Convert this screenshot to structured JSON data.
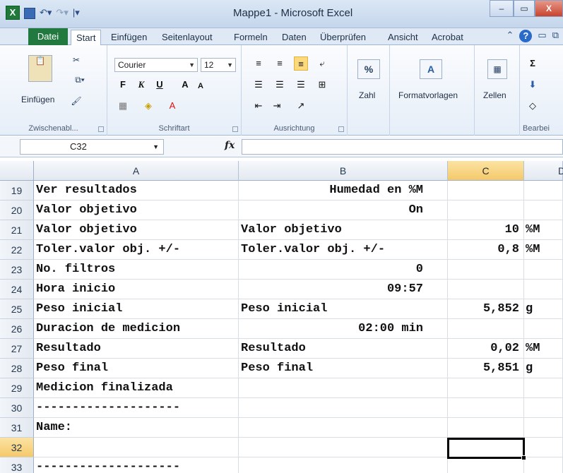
{
  "window": {
    "app_icon": "X",
    "title": "Mappe1 - Microsoft Excel",
    "min_label": "–",
    "max_label": "▭",
    "close_label": "X"
  },
  "ribbon_tabs": [
    "Datei",
    "Start",
    "Einfügen",
    "Seitenlayout",
    "Formeln",
    "Daten",
    "Überprüfen",
    "Ansicht",
    "Acrobat"
  ],
  "ribbon": {
    "clipboard": {
      "paste_label": "Einfügen",
      "group_label": "Zwischenabl..."
    },
    "font": {
      "font_name": "Courier",
      "font_size": "12",
      "bold": "F",
      "italic": "K",
      "underline": "U",
      "grow": "A",
      "shrink": "A",
      "group_label": "Schriftart"
    },
    "alignment": {
      "group_label": "Ausrichtung"
    },
    "number": {
      "label": "Zahl",
      "symbol": "%"
    },
    "styles": {
      "label": "Formatvorlagen"
    },
    "cells": {
      "label": "Zellen"
    },
    "editing": {
      "sum": "Σ",
      "group_label": "Bearbei"
    }
  },
  "formula_bar": {
    "name_box": "C32",
    "fx": "fx",
    "value": ""
  },
  "columns": [
    "A",
    "B",
    "C",
    "D"
  ],
  "selected_cell": "C32",
  "rows": [
    {
      "n": "19",
      "A": "Ver resultados",
      "B": "Humedad en %M",
      "C": "",
      "D": ""
    },
    {
      "n": "20",
      "A": "Valor objetivo",
      "B": "On",
      "C": "",
      "D": ""
    },
    {
      "n": "21",
      "A": "Valor objetivo",
      "B": "Valor objetivo",
      "C": "10",
      "D": "%M"
    },
    {
      "n": "22",
      "A": "Toler.valor obj. +/-",
      "B": "Toler.valor obj. +/-",
      "C": "0,8",
      "D": "%M"
    },
    {
      "n": "23",
      "A": "No. filtros",
      "B": "0",
      "C": "",
      "D": ""
    },
    {
      "n": "24",
      "A": "Hora inicio",
      "B": "09:57",
      "C": "",
      "D": ""
    },
    {
      "n": "25",
      "A": "Peso inicial",
      "B": "Peso inicial",
      "C": "5,852",
      "D": "g"
    },
    {
      "n": "26",
      "A": "Duracion de medicion",
      "B": "02:00 min",
      "C": "",
      "D": ""
    },
    {
      "n": "27",
      "A": "Resultado",
      "B": "Resultado",
      "C": "0,02",
      "D": "%M"
    },
    {
      "n": "28",
      "A": "Peso final",
      "B": "Peso final",
      "C": "5,851",
      "D": "g"
    },
    {
      "n": "29",
      "A": "Medicion finalizada",
      "B": "",
      "C": "",
      "D": ""
    },
    {
      "n": "30",
      "A": "--------------------",
      "B": "",
      "C": "",
      "D": ""
    },
    {
      "n": "31",
      "A": "Name:",
      "B": "",
      "C": "",
      "D": ""
    },
    {
      "n": "32",
      "A": "",
      "B": "",
      "C": "",
      "D": ""
    },
    {
      "n": "33",
      "A": "--------------------",
      "B": "",
      "C": "",
      "D": ""
    }
  ]
}
